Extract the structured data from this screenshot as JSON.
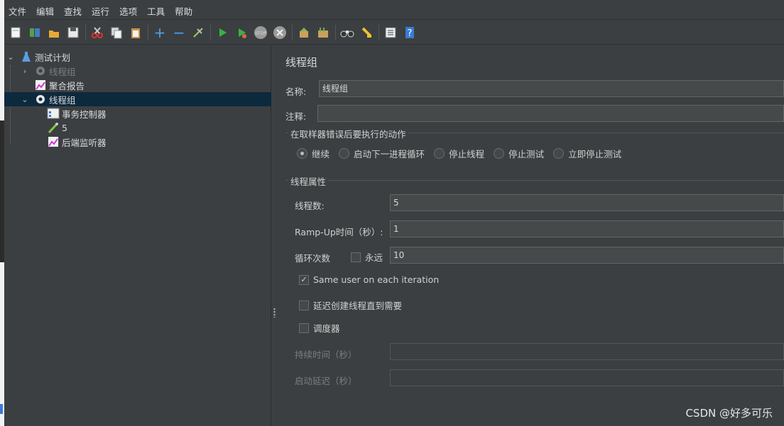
{
  "menu": [
    "文件",
    "编辑",
    "查找",
    "运行",
    "选项",
    "工具",
    "帮助"
  ],
  "toolbar": {
    "icons": [
      "new-icon",
      "templates-icon",
      "open-icon",
      "save-icon",
      "cut-icon",
      "copy-icon",
      "paste-icon",
      "expand-icon",
      "collapse-icon",
      "toggle-icon",
      "start-icon",
      "start-no-pause-icon",
      "stop-icon",
      "shutdown-icon",
      "clear-icon",
      "clear-all-icon",
      "search-icon",
      "reset-search-icon",
      "function-helper-icon",
      "help-icon"
    ],
    "colors": {
      "start": "#3cb043",
      "stop": "#9a9a9a"
    }
  },
  "tree": {
    "items": [
      {
        "label": "测试计划",
        "icon": "test-plan-icon",
        "expanded": true
      },
      {
        "label": "线程组",
        "icon": "thread-group-icon",
        "disabled": true
      },
      {
        "label": "聚合报告",
        "icon": "aggregate-report-icon"
      },
      {
        "label": "线程组",
        "icon": "thread-group-icon",
        "selected": true,
        "expanded": true
      },
      {
        "label": "事务控制器",
        "icon": "transaction-controller-icon"
      },
      {
        "label": "5",
        "icon": "sampler-icon"
      },
      {
        "label": "后端监听器",
        "icon": "backend-listener-icon"
      }
    ],
    "selected_bg": "#0d293e"
  },
  "panel": {
    "title": "线程组",
    "name_label": "名称:",
    "name_value": "线程组",
    "comment_label": "注释:",
    "comment_value": "",
    "error_group_title": "在取样器错误后要执行的动作",
    "error_actions": [
      {
        "label": "继续",
        "selected": true
      },
      {
        "label": "启动下一进程循环",
        "selected": false
      },
      {
        "label": "停止线程",
        "selected": false
      },
      {
        "label": "停止测试",
        "selected": false
      },
      {
        "label": "立即停止测试",
        "selected": false
      }
    ],
    "props_group_title": "线程属性",
    "threads_label": "线程数:",
    "threads_value": "5",
    "rampup_label": "Ramp-Up时间（秒）:",
    "rampup_value": "1",
    "loop_label": "循环次数",
    "forever_label": "永远",
    "forever_checked": false,
    "loop_value": "10",
    "same_user_label": "Same user on each iteration",
    "same_user_checked": true,
    "delay_create_label": "延迟创建线程直到需要",
    "delay_create_checked": false,
    "scheduler_label": "调度器",
    "scheduler_checked": false,
    "duration_label": "持续时间（秒）",
    "duration_value": "",
    "startup_delay_label": "启动延迟（秒）",
    "startup_delay_value": ""
  },
  "watermark": "CSDN @好多可乐"
}
